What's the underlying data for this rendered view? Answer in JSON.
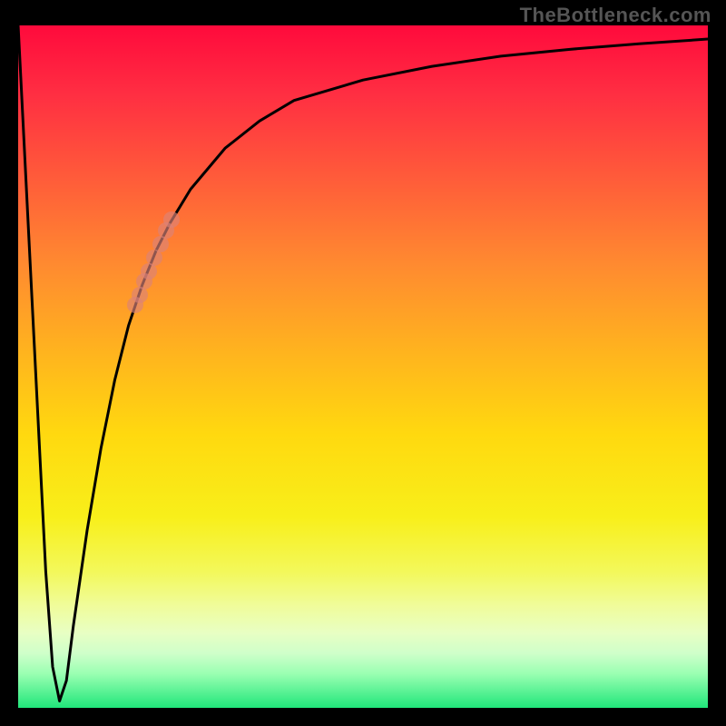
{
  "source_label": "TheBottleneck.com",
  "colors": {
    "frame_bg": "#000000",
    "curve": "#000000",
    "marker": "rgba(220,130,120,0.65)",
    "source_text": "#555555"
  },
  "chart_data": {
    "type": "line",
    "title": "",
    "xlabel": "",
    "ylabel": "",
    "xlim": [
      0,
      100
    ],
    "ylim": [
      0,
      100
    ],
    "grid": false,
    "legend": false,
    "description": "Single black curve over vertical rainbow gradient (red top → green bottom). Curve falls sharply from top-left to a near-zero minimum around x≈6, then rises steeply and asymptotically flattens toward the top-right. A short run of semi-transparent salmon dots lies on the rising limb between roughly x≈17 and x≈22.",
    "series": [
      {
        "name": "curve",
        "x": [
          0,
          2,
          4,
          5,
          6,
          7,
          8,
          10,
          12,
          14,
          16,
          18,
          20,
          22,
          25,
          30,
          35,
          40,
          50,
          60,
          70,
          80,
          90,
          100
        ],
        "values": [
          100,
          60,
          20,
          6,
          1,
          4,
          12,
          26,
          38,
          48,
          56,
          62,
          67,
          71,
          76,
          82,
          86,
          89,
          92,
          94,
          95.5,
          96.5,
          97.3,
          98
        ]
      }
    ],
    "markers": [
      {
        "x": 17.0,
        "y": 59.0
      },
      {
        "x": 17.6,
        "y": 60.5
      },
      {
        "x": 18.3,
        "y": 62.5
      },
      {
        "x": 19.0,
        "y": 64.0
      },
      {
        "x": 19.8,
        "y": 66.0
      },
      {
        "x": 20.6,
        "y": 68.0
      },
      {
        "x": 21.4,
        "y": 70.0
      },
      {
        "x": 22.2,
        "y": 71.5
      }
    ]
  }
}
